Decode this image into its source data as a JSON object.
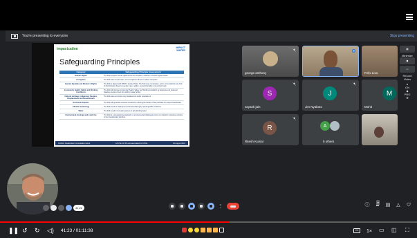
{
  "banner": {
    "text": "You're presenting to everyone",
    "stop_label": "Stop presenting"
  },
  "slide": {
    "logo_left": "impactcation",
    "logo_right_line1": "IMPACT",
    "logo_right_line2": "WATER",
    "title": "Safeguarding Principles",
    "col_category": "Category",
    "col_assessment": "Safeguarding Principle Assessment",
    "rows": [
      {
        "category": "Human Rights",
        "text": "The Park respects human rights and is not complicit in violence or human rights abuses."
      },
      {
        "category": "Corruption",
        "text": "The Park does not promote, nor is complicit in direct or indirect corruption."
      },
      {
        "category": "Gender Equality and Women's Rights",
        "text": "The Park is aligned with IDWC's Gender Policy. The Park does not propose, and is not complicit in any form of discrimination based on gender, race, religion, sexual orientation or any other basis."
      },
      {
        "category": "Community Health, Safety and Working Conditions",
        "text": "The Park will improve Community Health, Safety and Working Conditions by deployment of treatment baseline counter-moves for existing / water boiling."
      },
      {
        "category": "Cultural Heritage, Indigenous Peoples, Displacement and Resettlement",
        "text": "The Park does not involve any displacement and/or resettlement."
      },
      {
        "category": "Economic Impacts",
        "text": "The Park will generate economic benefits by reducing the burden of fuel purchase for project beneficiaries."
      },
      {
        "category": "Climate and Energy",
        "text": "The Park results in deployment of Gravity filtering by reducing GHG emissions."
      },
      {
        "category": "Water",
        "text": "The Park result in increasing access to safe drinking water."
      },
      {
        "category": "Environment, Ecology and Land Use",
        "text": "The Park is a precautionary approach on environmental challenges and is not complicit in practices contrary to the precautionary principle."
      }
    ],
    "footer_left": "GS4GG Stakeholder Consultation Event",
    "footer_mid": "GS Pub 11705 and associated GS VPAs",
    "footer_right": "31 August 2021"
  },
  "participants": [
    {
      "name": "george anthony",
      "kind": "photo"
    },
    {
      "name": "",
      "kind": "video"
    },
    {
      "name": "Felix Lisa",
      "kind": "video"
    },
    {
      "name": "sayank jain",
      "kind": "avatar",
      "initial": "S",
      "color": "#9c27b0"
    },
    {
      "name": "Jim Nyaboto",
      "kind": "avatar",
      "initial": "J",
      "color": "#00897b"
    },
    {
      "name": "Mohit",
      "kind": "avatar",
      "initial": "M",
      "color": "#00695c"
    },
    {
      "name": "Ritesh Kumar",
      "kind": "avatar",
      "initial": "R",
      "color": "#795548"
    },
    {
      "name": "5 others",
      "kind": "group",
      "initial": "A",
      "color": "#43a047"
    },
    {
      "name": "",
      "kind": "video"
    }
  ],
  "side_panel": {
    "minimize": "Minimize",
    "record_line1": "Record",
    "record_line2": "Video",
    "on": "ON",
    "pro": "PRO"
  },
  "self_view": {
    "label": "GO",
    "time": "41:22"
  },
  "right_icons": {
    "people_count": "25"
  },
  "player": {
    "progress_fraction": 0.55,
    "time": "41:23 / 01:11:38",
    "speed": "1×"
  }
}
